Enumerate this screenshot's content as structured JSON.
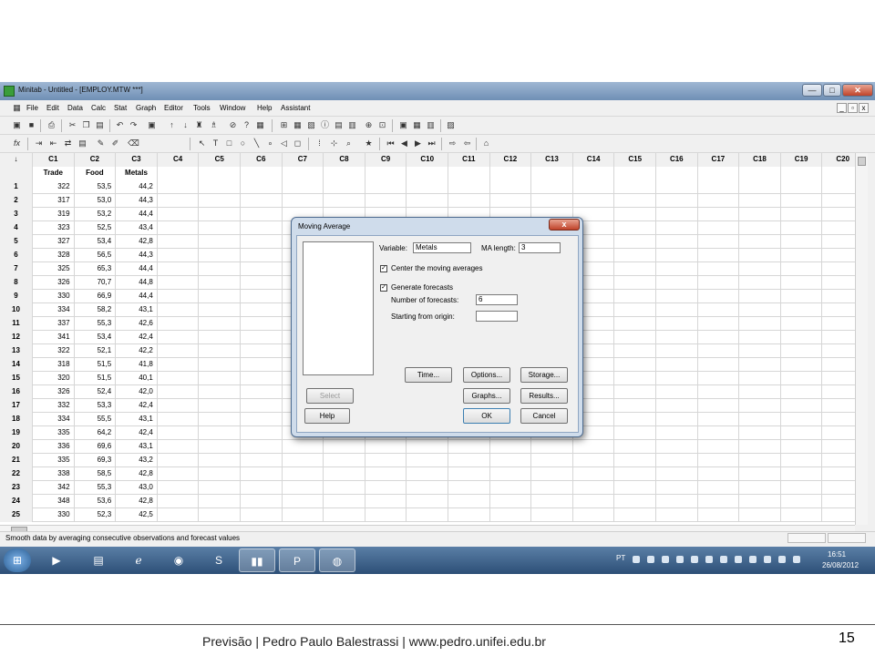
{
  "window": {
    "title": "Minitab - Untitled - [EMPLOY.MTW ***]",
    "controls": [
      "—",
      "□",
      "✕"
    ]
  },
  "menu": [
    "File",
    "Edit",
    "Data",
    "Calc",
    "Stat",
    "Graph",
    "Editor",
    "Tools",
    "Window",
    "Help",
    "Assistant"
  ],
  "doc_controls": [
    "_",
    "▫",
    "x"
  ],
  "worksheet": {
    "corner": "↓",
    "columns": [
      "C1",
      "C2",
      "C3",
      "C4",
      "C5",
      "C6",
      "C7",
      "C8",
      "C9",
      "C10",
      "C11",
      "C12",
      "C13",
      "C14",
      "C15",
      "C16",
      "C17",
      "C18",
      "C19",
      "C20"
    ],
    "names": [
      "Trade",
      "Food",
      "Metals"
    ],
    "rows": [
      [
        "1",
        "322",
        "53,5",
        "44,2"
      ],
      [
        "2",
        "317",
        "53,0",
        "44,3"
      ],
      [
        "3",
        "319",
        "53,2",
        "44,4"
      ],
      [
        "4",
        "323",
        "52,5",
        "43,4"
      ],
      [
        "5",
        "327",
        "53,4",
        "42,8"
      ],
      [
        "6",
        "328",
        "56,5",
        "44,3"
      ],
      [
        "7",
        "325",
        "65,3",
        "44,4"
      ],
      [
        "8",
        "326",
        "70,7",
        "44,8"
      ],
      [
        "9",
        "330",
        "66,9",
        "44,4"
      ],
      [
        "10",
        "334",
        "58,2",
        "43,1"
      ],
      [
        "11",
        "337",
        "55,3",
        "42,6"
      ],
      [
        "12",
        "341",
        "53,4",
        "42,4"
      ],
      [
        "13",
        "322",
        "52,1",
        "42,2"
      ],
      [
        "14",
        "318",
        "51,5",
        "41,8"
      ],
      [
        "15",
        "320",
        "51,5",
        "40,1"
      ],
      [
        "16",
        "326",
        "52,4",
        "42,0"
      ],
      [
        "17",
        "332",
        "53,3",
        "42,4"
      ],
      [
        "18",
        "334",
        "55,5",
        "43,1"
      ],
      [
        "19",
        "335",
        "64,2",
        "42,4"
      ],
      [
        "20",
        "336",
        "69,6",
        "43,1"
      ],
      [
        "21",
        "335",
        "69,3",
        "43,2"
      ],
      [
        "22",
        "338",
        "58,5",
        "42,8"
      ],
      [
        "23",
        "342",
        "55,3",
        "43,0"
      ],
      [
        "24",
        "348",
        "53,6",
        "42,8"
      ],
      [
        "25",
        "330",
        "52,3",
        "42,5"
      ]
    ]
  },
  "status": "Smooth data by averaging consecutive observations and forecast values",
  "dialog": {
    "title": "Moving Average",
    "close": "x",
    "variable_label": "Variable:",
    "variable_value": "Metals",
    "ma_length_label": "MA length:",
    "ma_length_value": "3",
    "center_label": "Center the moving averages",
    "center_checked": "✓",
    "forecast_label": "Generate forecasts",
    "forecast_checked": "✓",
    "num_forecasts_label": "Number of forecasts:",
    "num_forecasts_value": "6",
    "origin_label": "Starting from origin:",
    "origin_value": "",
    "buttons": {
      "select": "Select",
      "help": "Help",
      "time": "Time...",
      "options": "Options...",
      "storage": "Storage...",
      "graphs": "Graphs...",
      "results": "Results...",
      "ok": "OK",
      "cancel": "Cancel"
    }
  },
  "taskbar": {
    "lang": "PT",
    "time": "16:51",
    "date": "26/08/2012"
  },
  "footer": {
    "text": "Previsão | Pedro Paulo Balestrassi | www.pedro.unifei.edu.br",
    "page": "15"
  }
}
